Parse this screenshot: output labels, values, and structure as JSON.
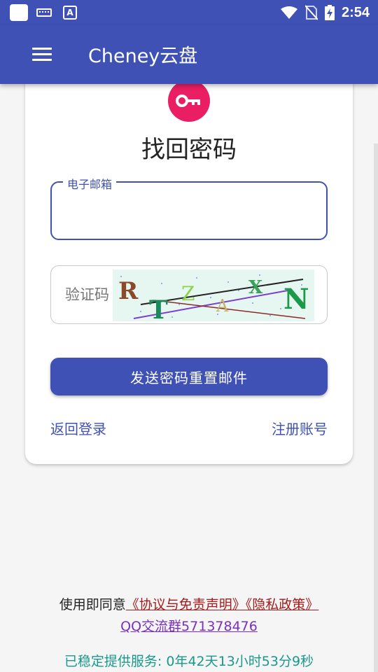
{
  "status_bar": {
    "time": "2:54",
    "icons": [
      "app-icon",
      "keyboard-icon",
      "a-icon",
      "wifi-icon",
      "no-sim-icon",
      "battery-charging-icon"
    ]
  },
  "app_bar": {
    "title": "Cheney云盘",
    "menu_icon": "menu-icon"
  },
  "card": {
    "icon": "key-icon",
    "title": "找回密码",
    "email": {
      "label": "电子邮箱",
      "value": ""
    },
    "captcha": {
      "placeholder": "验证码",
      "value": "",
      "image_text": "RTZAXN"
    },
    "send_button": "发送密码重置邮件",
    "back_to_login": "返回登录",
    "register": "注册账号"
  },
  "footer": {
    "agree_prefix": "使用即同意",
    "agreement_link": "《协议与免责声明》《隐私政策》",
    "qq_group": "QQ交流群571378476",
    "uptime": "已稳定提供服务: 0年42天13小时53分9秒"
  },
  "colors": {
    "primary": "#3f51b5",
    "accent": "#e91e63",
    "link_red": "#a61b1b",
    "link_purple": "#7b2fbf",
    "uptime_teal": "#19998c"
  }
}
